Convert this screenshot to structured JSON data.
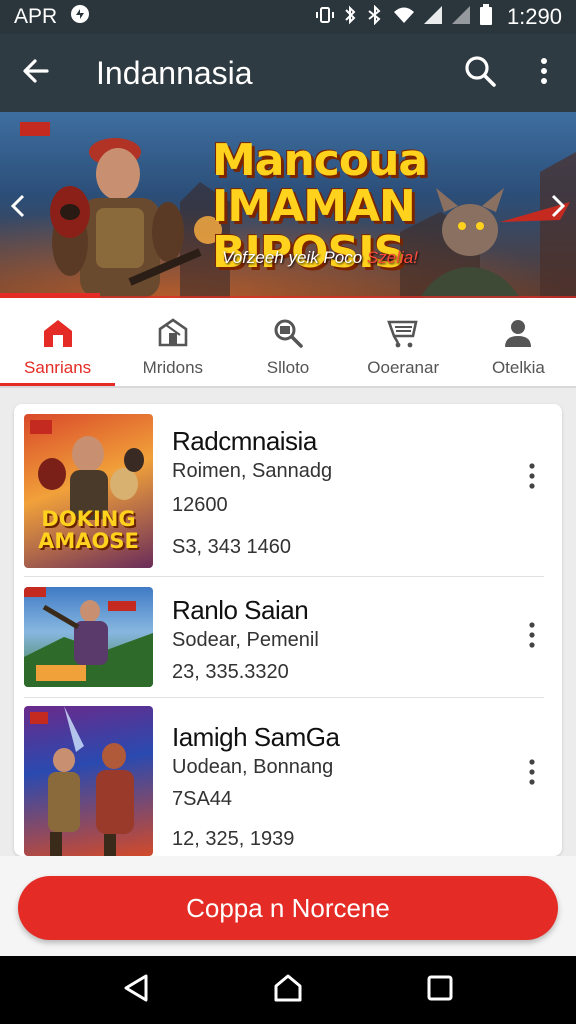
{
  "status_bar": {
    "left_text": "APR",
    "time": "1:290",
    "icons": [
      "notification-icon",
      "vibrate-icon",
      "bluetooth-icon",
      "wifi-icon",
      "signal-icon",
      "signal-icon",
      "battery-icon"
    ]
  },
  "app_bar": {
    "title": "Indannasia",
    "icons": [
      "back-arrow-icon",
      "search-icon",
      "more-vert-icon"
    ]
  },
  "banner": {
    "title_line1": "Mancoua IMAMAN",
    "title_line2": "BIPOSIS",
    "tagline_white": "Vofzeeh yeik Poco ",
    "tagline_red": "Szelia!",
    "icons": [
      "chevron-left-icon",
      "chevron-right-icon"
    ]
  },
  "tabs": [
    {
      "label": "Sanrians",
      "icon": "home-icon",
      "active": true
    },
    {
      "label": "Mridons",
      "icon": "store-icon",
      "active": false
    },
    {
      "label": "Slloto",
      "icon": "search-box-icon",
      "active": false
    },
    {
      "label": "Ooeranar",
      "icon": "cart-icon",
      "active": false
    },
    {
      "label": "Otelkia",
      "icon": "person-icon",
      "active": false
    }
  ],
  "list": [
    {
      "title": "Radcmnaisia",
      "subtitle": "Roimen, Sannadg",
      "number": "12600",
      "meta": "S3,  343 1460",
      "thumb_text_line1": "DOKING",
      "thumb_text_line2": "AMAOSE"
    },
    {
      "title": "Ranlo Saian",
      "subtitle": "Sodear, Pemenil",
      "number": "",
      "meta": "23,  335.3320",
      "thumb_text_line1": "",
      "thumb_text_line2": ""
    },
    {
      "title": "Iamigh SamGa",
      "subtitle": "Uodean, Bonnang",
      "number": "7SA44",
      "meta": "12,  325, 1939",
      "thumb_text_line1": "",
      "thumb_text_line2": ""
    }
  ],
  "cta": {
    "label": "Coppa n Norcene"
  },
  "nav_bar": {
    "icons": [
      "back-triangle-icon",
      "home-circle-icon",
      "recents-square-icon"
    ]
  },
  "colors": {
    "accent": "#e42b25",
    "app_bar": "#2f3b42",
    "status_bar": "#2a353c",
    "title_gold": "#ffd21e"
  }
}
